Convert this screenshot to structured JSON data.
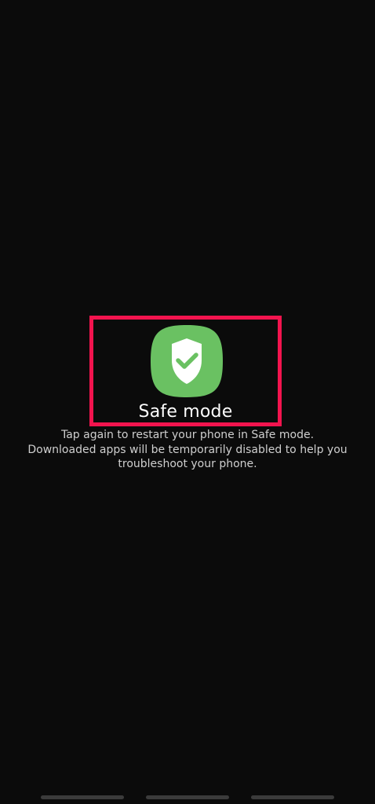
{
  "safe_mode": {
    "label": "Safe mode",
    "icon": "shield-check-icon",
    "icon_color": "#6ac162",
    "highlight_color": "#f2144e",
    "description": "Tap again to restart your phone in Safe mode. Downloaded apps will be temporarily disabled to help you troubleshoot your phone."
  },
  "navigation": {
    "items": [
      "recent-apps-handle",
      "home-handle",
      "back-handle"
    ]
  }
}
